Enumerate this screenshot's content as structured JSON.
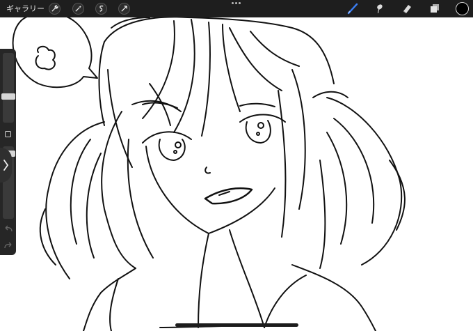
{
  "toolbar": {
    "gallery_label": "ギャラリー",
    "left_actions": [
      "wrench-icon",
      "magic-wand-icon",
      "selection-icon",
      "transform-icon"
    ],
    "right_tools": [
      "brush-icon",
      "smudge-icon",
      "eraser-icon",
      "layers-icon"
    ],
    "active_tool": "brush-icon",
    "active_color": "#000000",
    "accent_color": "#3b7ff5"
  },
  "sidebar": {
    "brush_size": 0.72,
    "opacity": 0.3
  }
}
